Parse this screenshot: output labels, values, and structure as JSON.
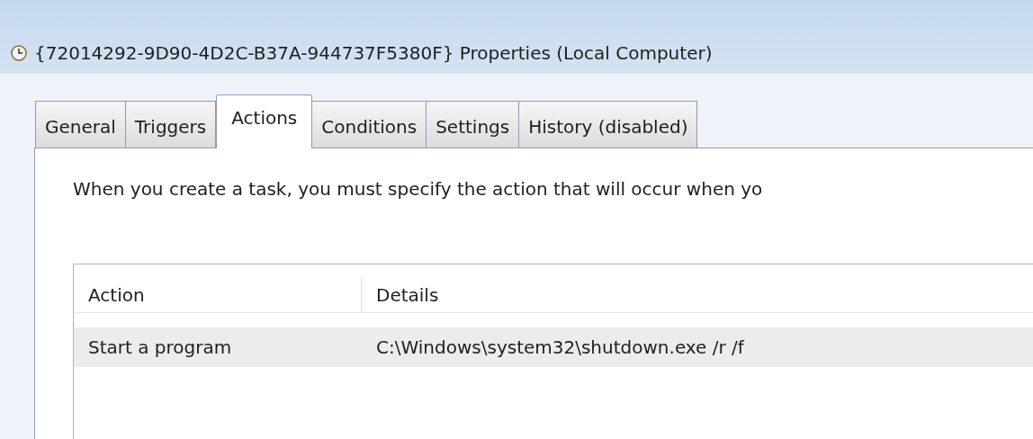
{
  "window": {
    "title": "{72014292-9D90-4D2C-B37A-944737F5380F} Properties (Local Computer)"
  },
  "tabs": [
    {
      "label": "General",
      "selected": false
    },
    {
      "label": "Triggers",
      "selected": false
    },
    {
      "label": "Actions",
      "selected": true
    },
    {
      "label": "Conditions",
      "selected": false
    },
    {
      "label": "Settings",
      "selected": false
    },
    {
      "label": "History (disabled)",
      "selected": false
    }
  ],
  "description": "When you create a task, you must specify the action that will occur when yo",
  "table": {
    "columns": [
      "Action",
      "Details"
    ],
    "rows": [
      {
        "cells": [
          "Start a program",
          "C:\\Windows\\system32\\shutdown.exe /r /f"
        ],
        "selected": true
      }
    ]
  }
}
